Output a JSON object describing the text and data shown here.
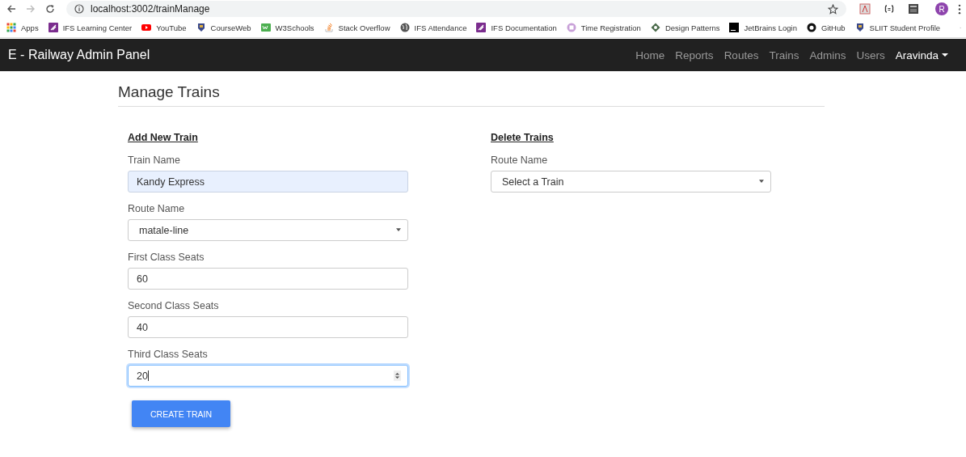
{
  "browser": {
    "url": "localhost:3002/trainManage",
    "profile_initial": "R"
  },
  "bookmarks": [
    {
      "label": "Apps",
      "kind": "apps"
    },
    {
      "label": "IFS Learning Center",
      "kind": "ifs"
    },
    {
      "label": "YouTube",
      "kind": "youtube"
    },
    {
      "label": "CourseWeb",
      "kind": "shield"
    },
    {
      "label": "W3Schools",
      "kind": "w3"
    },
    {
      "label": "Stack Overflow",
      "kind": "stack"
    },
    {
      "label": "IFS Attendance",
      "kind": "globe"
    },
    {
      "label": "IFS Documentation",
      "kind": "ifs"
    },
    {
      "label": "Time Registration",
      "kind": "clock"
    },
    {
      "label": "Design Patterns",
      "kind": "diamond"
    },
    {
      "label": "JetBrains Login",
      "kind": "jb"
    },
    {
      "label": "GitHub",
      "kind": "github"
    },
    {
      "label": "SLIIT Student Profile",
      "kind": "shield"
    }
  ],
  "navbar": {
    "brand": "E - Railway Admin Panel",
    "items": [
      {
        "label": "Home",
        "kind": "link"
      },
      {
        "label": "Reports",
        "kind": "link"
      },
      {
        "label": "Routes",
        "kind": "link"
      },
      {
        "label": "Trains",
        "kind": "link"
      },
      {
        "label": "Admins",
        "kind": "link"
      },
      {
        "label": "Users",
        "kind": "link"
      },
      {
        "label": "Aravinda",
        "kind": "dropdown"
      }
    ]
  },
  "page_title": "Manage Trains",
  "add_form": {
    "heading": "Add New Train",
    "fields": [
      {
        "label": "Train Name",
        "kind": "text",
        "value": "Kandy Express",
        "autofilled": true,
        "focused": false
      },
      {
        "label": "Route Name",
        "kind": "select",
        "value": "matale-line",
        "autofilled": false,
        "focused": false
      },
      {
        "label": "First Class Seats",
        "kind": "text",
        "value": "60",
        "autofilled": false,
        "focused": false
      },
      {
        "label": "Second Class Seats",
        "kind": "text",
        "value": "40",
        "autofilled": false,
        "focused": false
      },
      {
        "label": "Third Class Seats",
        "kind": "number",
        "value": "20",
        "autofilled": false,
        "focused": true
      }
    ],
    "button": "CREATE TRAIN"
  },
  "delete_form": {
    "heading": "Delete Trains",
    "fields": [
      {
        "label": "Route Name",
        "kind": "select",
        "value": "Select a Train",
        "autofilled": false,
        "focused": false
      }
    ]
  }
}
